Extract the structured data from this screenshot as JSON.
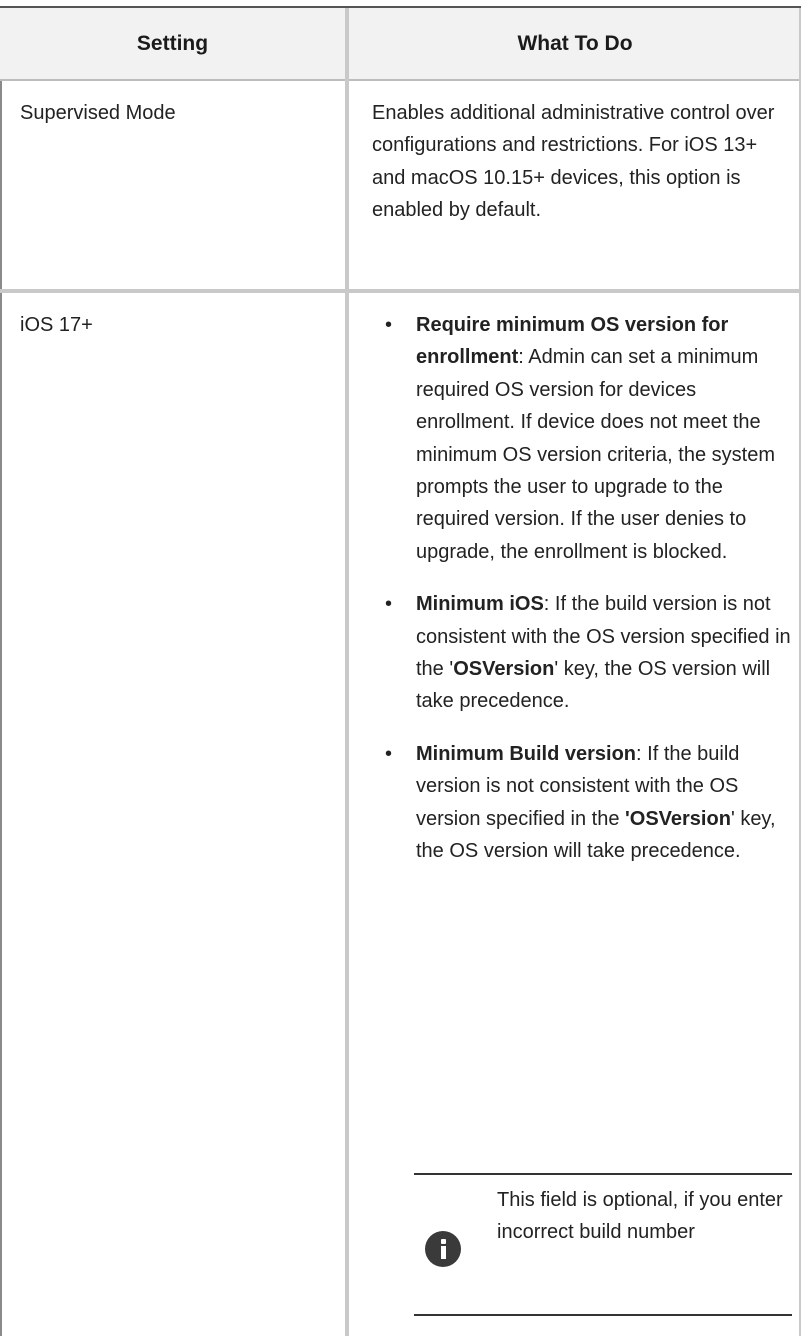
{
  "table": {
    "headers": {
      "setting": "Setting",
      "what_to_do": "What To Do"
    },
    "rows": [
      {
        "setting": "Supervised Mode",
        "description": "Enables additional administrative control over configurations and restrictions. For iOS 13+ and macOS 10.15+ devices, this option is enabled by default."
      },
      {
        "setting": "iOS 17+",
        "bullets": [
          {
            "term": "Require minimum OS version for enrollment",
            "text": ": Admin can set a minimum required OS version for devices enrollment. If device does not meet the minimum OS version criteria, the system prompts the user to upgrade to the required version. If the user denies to upgrade, the enrollment is blocked."
          },
          {
            "term": "Minimum iOS",
            "text_before": ": If the build version is not consistent with the OS version specified in the '",
            "key": "OSVersion",
            "text_after": "' key, the OS version will take precedence."
          },
          {
            "term": "Minimum Build version",
            "text_before": ": If the build version is not consistent with the OS version specified in the ",
            "key": "'OSVersion",
            "text_after": "' key, the OS version will take precedence."
          }
        ],
        "note": {
          "icon": "info-icon",
          "text": "This field is optional, if you enter incorrect build number"
        }
      }
    ]
  }
}
